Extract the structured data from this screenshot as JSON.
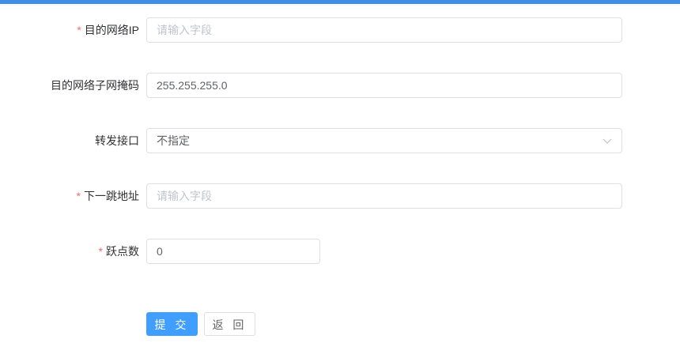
{
  "form": {
    "fields": [
      {
        "label": "目的网络IP",
        "required": true,
        "value": "",
        "placeholder": "请输入字段"
      },
      {
        "label": "目的网络子网掩码",
        "required": false,
        "value": "255.255.255.0",
        "placeholder": ""
      },
      {
        "label": "转发接口",
        "required": false,
        "value": "不指定",
        "type": "select",
        "icon": "chevron-down-icon"
      },
      {
        "label": "下一跳地址",
        "required": true,
        "value": "",
        "placeholder": "请输入字段"
      },
      {
        "label": "跃点数",
        "required": true,
        "value": "0",
        "placeholder": ""
      }
    ],
    "required_mark": "*",
    "submit_label": "提 交",
    "back_label": "返 回"
  },
  "colors": {
    "top_bar": "#3c8ee6",
    "primary": "#409eff",
    "required": "#f56c6c",
    "border": "#dcdfe6",
    "placeholder": "#c0c4cc"
  }
}
